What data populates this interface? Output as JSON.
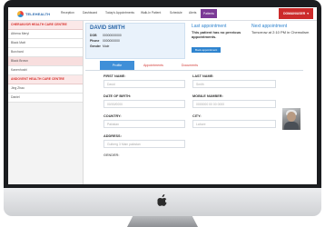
{
  "nav": {
    "brand": "TELEHEALTH",
    "items": [
      "Reception",
      "Dashboard",
      "Today's Appointments",
      "Walk-In Patient",
      "Schedule",
      "Alerts",
      "Patients"
    ],
    "active_index": 6,
    "user_label": "DOMAIN\\USER"
  },
  "sidebar": {
    "sections": [
      {
        "title": "CHERANVOR HEALTH CARE CENTRE",
        "items": [
          "Athena Meryl",
          "Black Matt",
          "Burchard",
          "Black Brown",
          "Kanenhoshi"
        ]
      },
      {
        "title": "ANDOVENT HEALTH CARE CENTRE",
        "items": [
          "Jing Zhao",
          "Daniel"
        ]
      }
    ],
    "selected": "Black Brown"
  },
  "profile": {
    "name": "DAVID SMITH",
    "fields": [
      {
        "label": "DOB",
        "value": "00000000000"
      },
      {
        "label": "Phone",
        "value": "0000000000"
      },
      {
        "label": "Gender",
        "value": "Male"
      }
    ]
  },
  "last_appointment": {
    "title": "Last appointment",
    "text": "This patient has no previous appointments.",
    "button": "Book appointment"
  },
  "next_appointment": {
    "title": "Next appointment",
    "text": "Tomorrow at 2:10 PM in Chemolism"
  },
  "tabs": [
    "Profile",
    "Appointments",
    "Documents"
  ],
  "active_tab": 0,
  "form": {
    "first_name": {
      "label": "FIRST NAME:",
      "value": "David"
    },
    "last_name": {
      "label": "LAST NAME:",
      "value": "Smith"
    },
    "dob": {
      "label": "DATE OF BIRTH:",
      "value": "00/00/0000"
    },
    "mobile": {
      "label": "MOBILE NUMBER:",
      "value": "0000000 00 00 0000"
    },
    "country": {
      "label": "COUNTRY:",
      "value": "Pakistan"
    },
    "city": {
      "label": "CITY:",
      "value": "Lahore"
    },
    "address": {
      "label": "ADDRESS:",
      "value": "Gulberg 3 Main pakistan"
    },
    "partial_label": "GENDER:"
  },
  "colors": {
    "brand_red": "#cc2b2b",
    "accent_blue": "#2f84cf",
    "active_nav": "#7b3a96",
    "section_red": "#d8322e"
  }
}
